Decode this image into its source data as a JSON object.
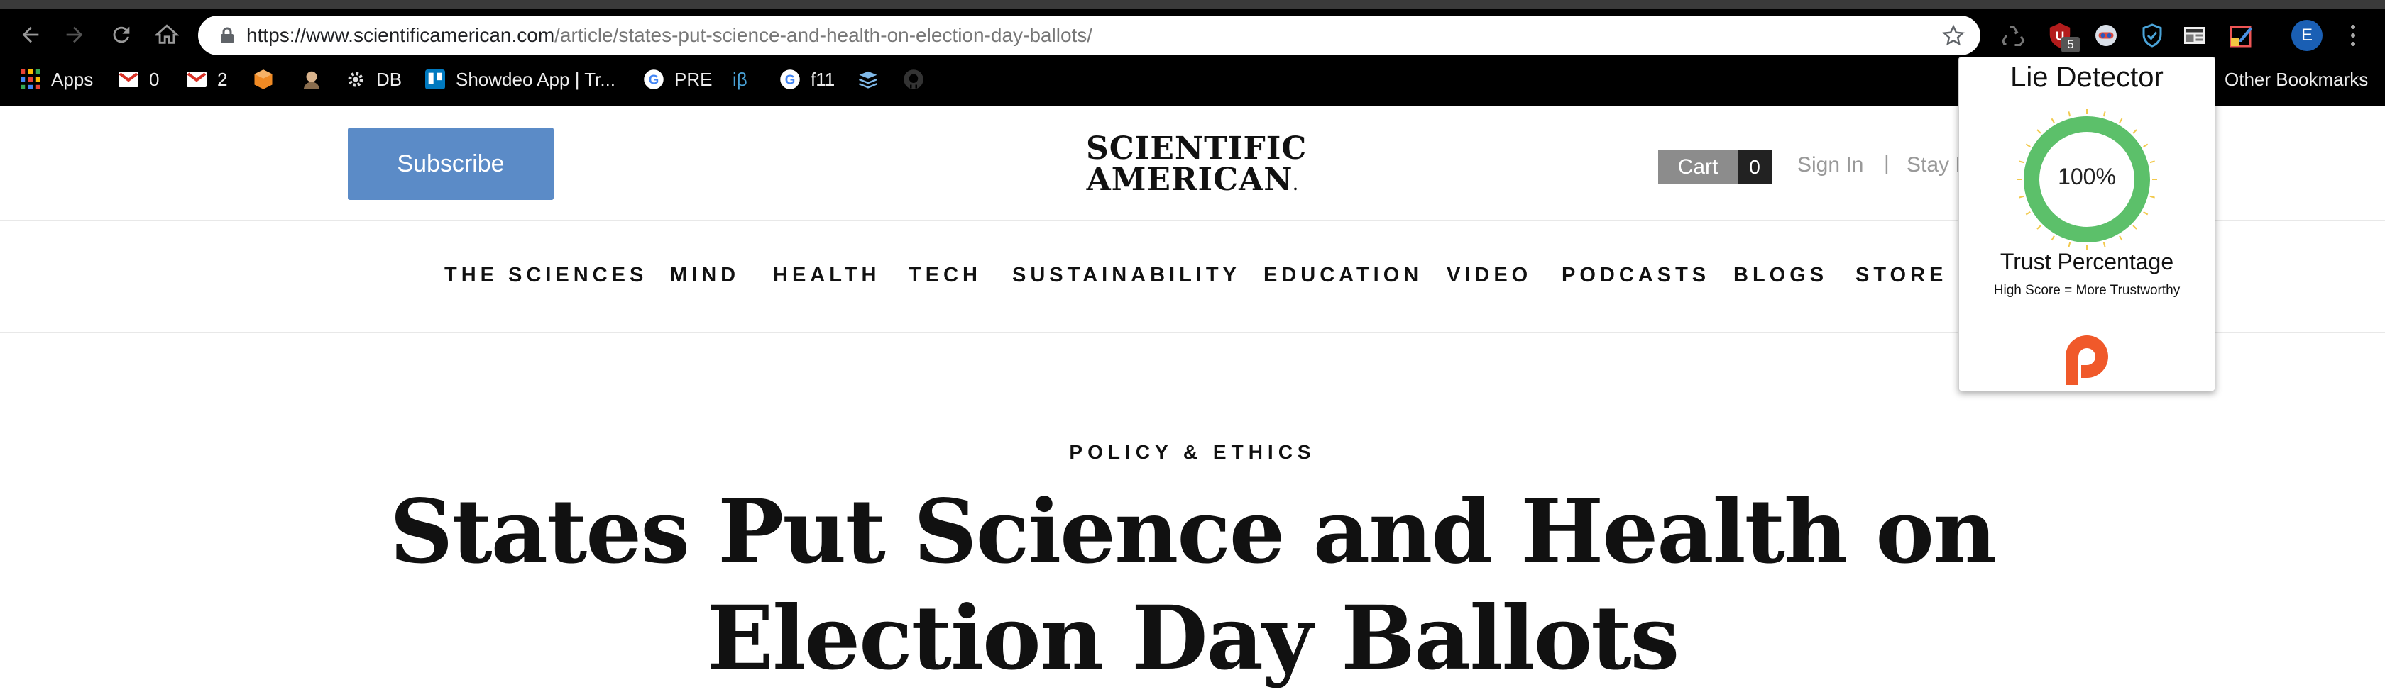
{
  "browser": {
    "url_host_part": "https://www.scientificamerican.com",
    "url_path_part": "/article/states-put-science-and-health-on-election-day-ballots/",
    "extension_badge": "5",
    "profile_initial": "E",
    "bookmarks": [
      {
        "label": "Apps",
        "icon": "apps-grid-icon"
      },
      {
        "label": "0",
        "icon": "gmail-icon"
      },
      {
        "label": "2",
        "icon": "gmail-icon"
      },
      {
        "label": "",
        "icon": "orange-cube-icon"
      },
      {
        "label": "",
        "icon": "avatar-icon"
      },
      {
        "label": "DB",
        "icon": "gear-icon"
      },
      {
        "label": "Showdeo App | Tr...",
        "icon": "trello-icon"
      },
      {
        "label": "PRE",
        "icon": "google-icon"
      },
      {
        "label": "iβ",
        "icon": "beta-icon"
      },
      {
        "label": "f11",
        "icon": "google-icon"
      },
      {
        "label": "",
        "icon": "layers-icon"
      },
      {
        "label": "",
        "icon": "github-icon"
      }
    ],
    "other_bookmarks": "Other Bookmarks"
  },
  "site": {
    "subscribe_label": "Subscribe",
    "logo_line1": "SCIENTIFIC",
    "logo_line2": "AMERICAN",
    "logo_mark": ".",
    "cart_label": "Cart",
    "cart_count": "0",
    "sign_in": "Sign In",
    "divider": "|",
    "stay_informed": "Stay I",
    "nav_items": [
      "THE SCIENCES",
      "MIND",
      "HEALTH",
      "TECH",
      "SUSTAINABILITY",
      "EDUCATION",
      "VIDEO",
      "PODCASTS",
      "BLOGS",
      "STORE"
    ]
  },
  "article": {
    "section": "POLICY & ETHICS",
    "headline_line1": "States Put Science and Health on",
    "headline_line2": "Election Day Ballots"
  },
  "popup": {
    "title": "Lie Detector",
    "gauge_value": "100%",
    "gauge_fraction": 1.0,
    "trust_label": "Trust Percentage",
    "trust_sub": "High Score = More Trustworthy",
    "accent_color": "#5cc06a",
    "brand_color": "#f0592a"
  }
}
